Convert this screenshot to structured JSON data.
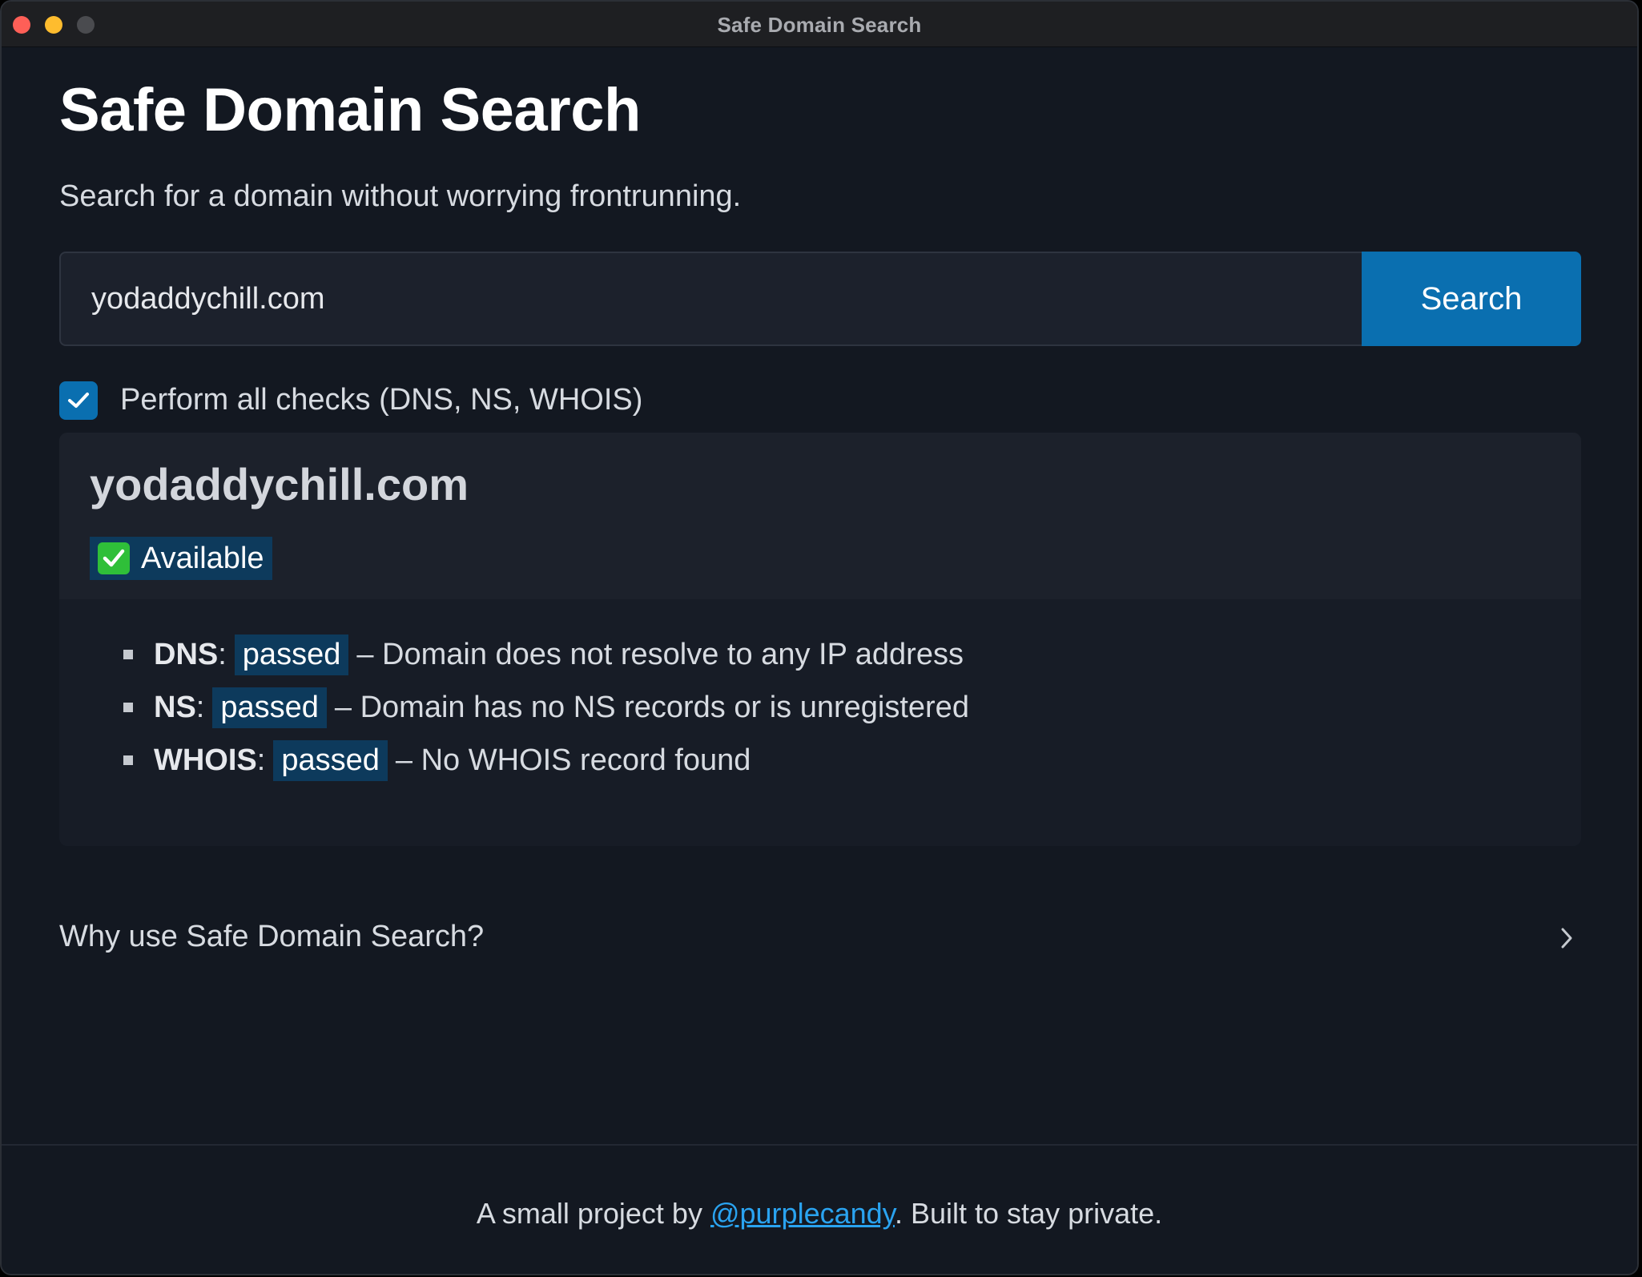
{
  "window": {
    "title": "Safe Domain Search"
  },
  "header": {
    "title": "Safe Domain Search",
    "subtitle": "Search for a domain without worrying frontrunning."
  },
  "search": {
    "value": "yodaddychill.com",
    "button_label": "Search"
  },
  "options": {
    "all_checks_label": "Perform all checks (DNS, NS, WHOIS)",
    "all_checks_checked": true
  },
  "result": {
    "domain": "yodaddychill.com",
    "status": "Available",
    "checks": [
      {
        "name": "DNS",
        "separator": ":",
        "result": "passed",
        "description": "– Domain does not resolve to any IP address"
      },
      {
        "name": "NS",
        "separator": ":",
        "result": "passed",
        "description": "– Domain has no NS records or is unregistered"
      },
      {
        "name": "WHOIS",
        "separator": ":",
        "result": "passed",
        "description": "– No WHOIS record found"
      }
    ]
  },
  "faq": {
    "label": "Why use Safe Domain Search?"
  },
  "footer": {
    "prefix": "A small project by ",
    "link_text": "@purplecandy",
    "suffix": ". Built to stay private."
  },
  "colors": {
    "background": "#131821",
    "accent": "#0a6fb0",
    "badge": "#0d3a5c",
    "link": "#2aa3f0"
  }
}
